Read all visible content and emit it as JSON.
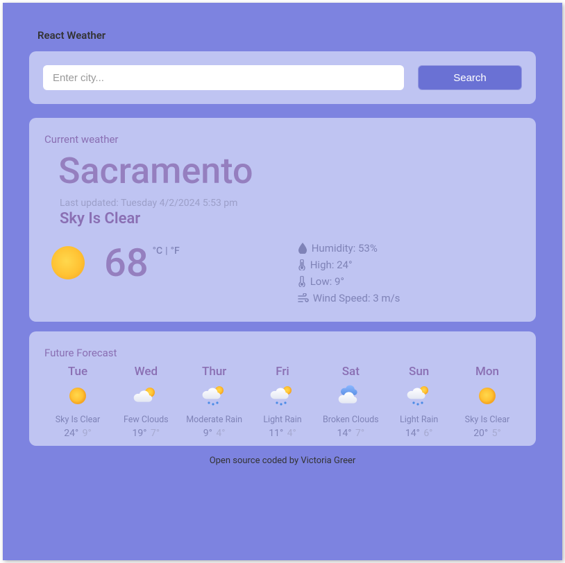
{
  "app_title": "React Weather",
  "search": {
    "placeholder": "Enter city...",
    "button_label": "Search"
  },
  "current": {
    "section_label": "Current weather",
    "city": "Sacramento",
    "last_updated": "Last updated: Tuesday 4/2/2024 5:53 pm",
    "condition": "Sky Is Clear",
    "temp": "68",
    "unit_c": "°C",
    "unit_sep": "|",
    "unit_f": "°F",
    "humidity_label": "Humidity: 53%",
    "high_label": "High: 24°",
    "low_label": "Low: 9°",
    "wind_label": "Wind Speed: 3 m/s"
  },
  "forecast": {
    "section_label": "Future Forecast",
    "days": [
      {
        "name": "Tue",
        "icon": "sun",
        "cond": "Sky Is Clear",
        "high": "24°",
        "low": "9°"
      },
      {
        "name": "Wed",
        "icon": "few-clouds",
        "cond": "Few Clouds",
        "high": "19°",
        "low": "7°"
      },
      {
        "name": "Thur",
        "icon": "rain-sun",
        "cond": "Moderate Rain",
        "high": "9°",
        "low": "4°"
      },
      {
        "name": "Fri",
        "icon": "rain-sun",
        "cond": "Light Rain",
        "high": "11°",
        "low": "4°"
      },
      {
        "name": "Sat",
        "icon": "clouds",
        "cond": "Broken Clouds",
        "high": "14°",
        "low": "7°"
      },
      {
        "name": "Sun",
        "icon": "rain-sun",
        "cond": "Light Rain",
        "high": "14°",
        "low": "6°"
      },
      {
        "name": "Mon",
        "icon": "sun",
        "cond": "Sky Is Clear",
        "high": "20°",
        "low": "5°"
      }
    ]
  },
  "footer": "Open source coded by Victoria Greer"
}
